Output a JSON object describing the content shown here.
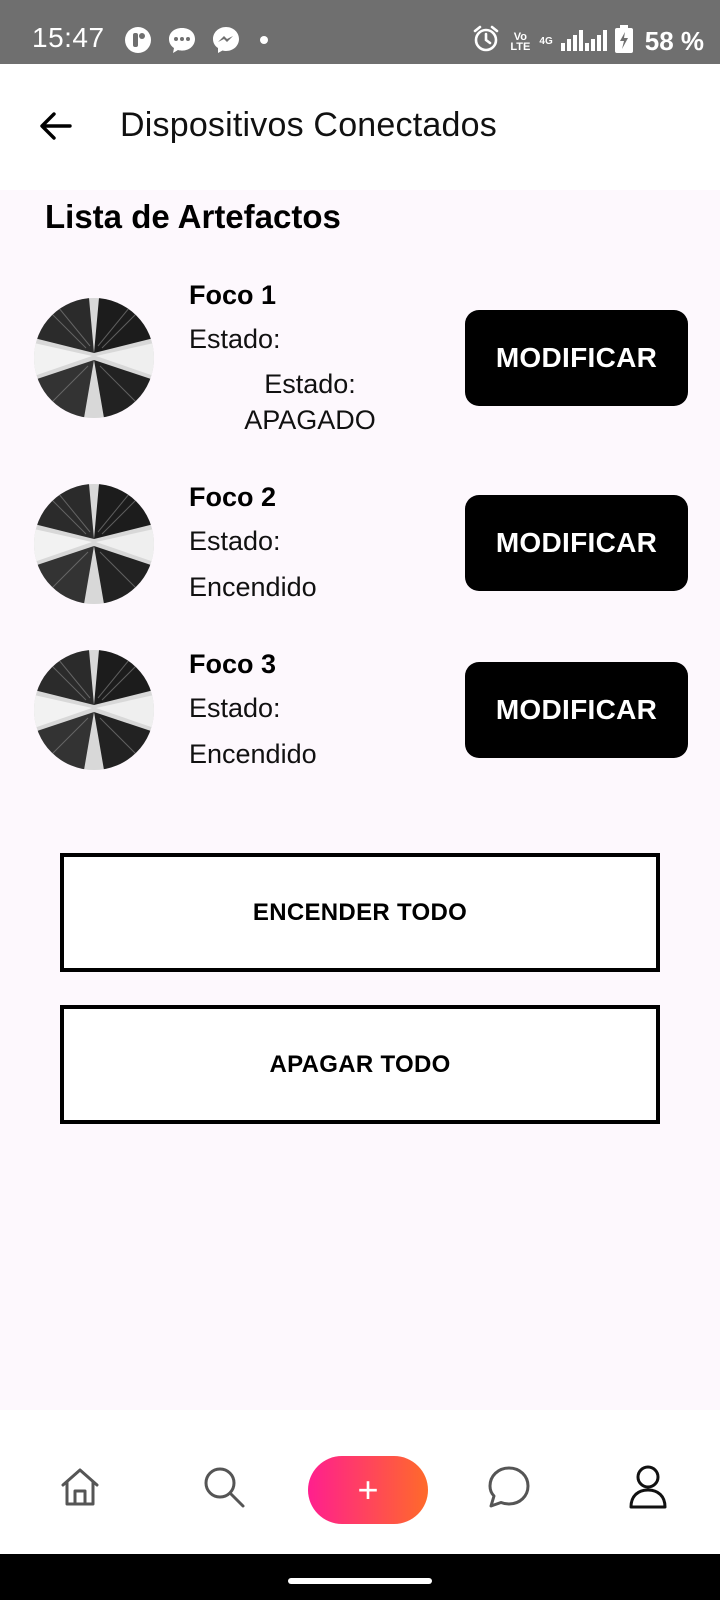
{
  "status_bar": {
    "time": "15:47",
    "notification_icons": [
      "tiktok-icon",
      "messages-icon",
      "messenger-icon"
    ],
    "network_volte": "Vo LTE",
    "network_type": "4G",
    "battery_percent": "58 %"
  },
  "app_bar": {
    "title": "Dispositivos Conectados",
    "back_icon": "arrow-back-icon"
  },
  "section_title": "Lista de Artefactos",
  "devices": [
    {
      "name": "Foco 1",
      "state_label": "Estado:",
      "state_value": "Estado:\nAPAGADO",
      "button": "MODIFICAR"
    },
    {
      "name": "Foco 2",
      "state_label": "Estado:",
      "state_value": "Encendido",
      "button": "MODIFICAR"
    },
    {
      "name": "Foco 3",
      "state_label": "Estado:",
      "state_value": "Encendido",
      "button": "MODIFICAR"
    }
  ],
  "actions": {
    "turn_on_all": "ENCENDER TODO",
    "turn_off_all": "APAGAR TODO"
  },
  "bottom_nav": {
    "items": [
      "home-icon",
      "search-icon",
      "add-icon",
      "chat-icon",
      "profile-icon"
    ],
    "fab_label": "+",
    "accent_gradient": [
      "#ff1f8e",
      "#ff6a2a"
    ]
  }
}
